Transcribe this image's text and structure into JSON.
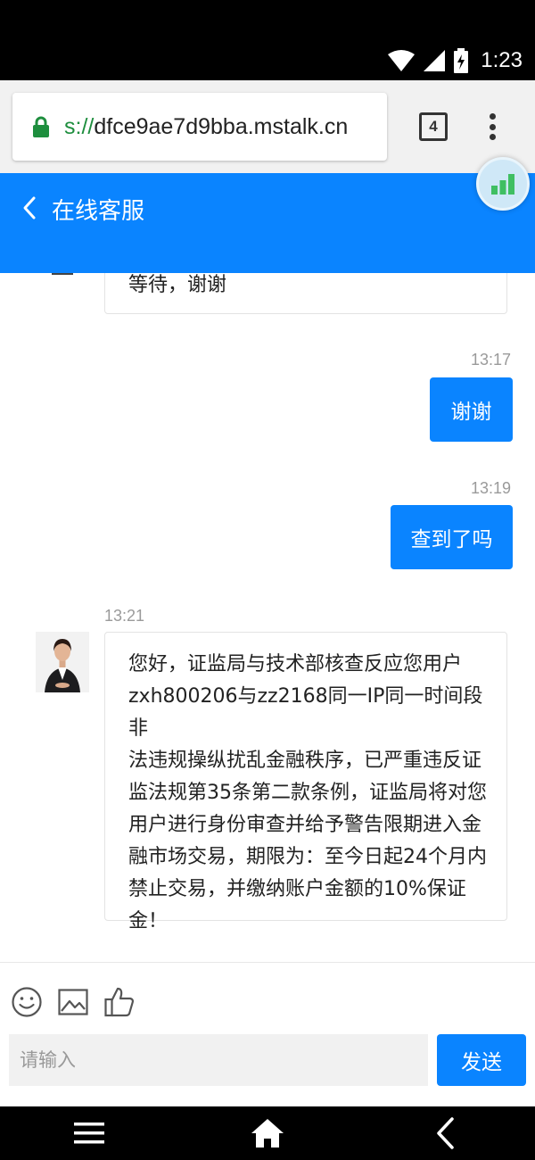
{
  "status_bar": {
    "time": "1:23",
    "icons": [
      "wifi-icon",
      "signal-icon",
      "battery-icon"
    ]
  },
  "browser": {
    "url_scheme": "s://",
    "url_host": "dfce9ae7d9bba.mstalk.cn",
    "tab_count": "4",
    "icons": [
      "lock-icon",
      "overflow-menu-icon"
    ]
  },
  "header": {
    "title": "在线客服",
    "back_icon": "chevron-left-icon",
    "color": "#0a84ff"
  },
  "messages": [
    {
      "side": "left",
      "text": "等待，谢谢"
    },
    {
      "side": "right",
      "time": "13:17",
      "text": "谢谢"
    },
    {
      "side": "right",
      "time": "13:19",
      "text": "查到了吗"
    },
    {
      "side": "left",
      "time": "13:21",
      "text": "您好，证监局与技术部核查反应您用户zxh800206与zz2168同一IP同一时间段非法违规操纵扰乱金融秩序，已严重违反证监法规第35条第二款条例，证监局将对您用户进行身份审查并给予警告限期进入金融市场交易，期限为：至今日起24个月内禁止交易，并缴纳账户金额的10%保证金！"
    }
  ],
  "message_lines": [
    "您好，证监局与技术部核查反应您用户",
    "zxh800206与zz2168同一IP同一时间段非",
    "法违规操纵扰乱金融秩序，已严重违反证",
    "监法规第35条第二款条例，证监局将对您",
    "用户进行身份审查并给予警告限期进入金",
    "融市场交易，期限为：至今日起24个月内",
    "禁止交易，并缴纳账户金额的10%保证",
    "金！"
  ],
  "input": {
    "placeholder": "请输入",
    "send_label": "发送",
    "tools": [
      "emoji-icon",
      "image-icon",
      "thumbs-up-icon"
    ]
  },
  "nav": {
    "icons": [
      "menu-icon",
      "home-icon",
      "back-icon"
    ]
  }
}
